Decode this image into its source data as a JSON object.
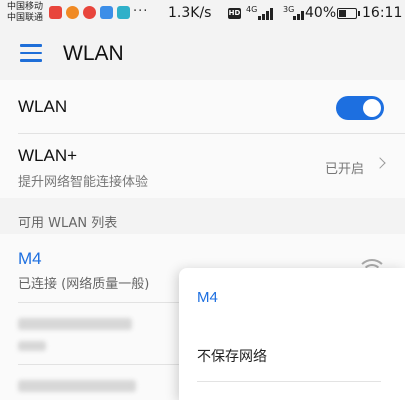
{
  "status_bar": {
    "carrier_1": "中国移动",
    "carrier_2": "中国联通",
    "dots": "···",
    "net_speed": "1.3K/s",
    "hd": "HD",
    "signal_1": "4G",
    "signal_2": "3G",
    "battery": "40%",
    "time": "16:11"
  },
  "app_bar": {
    "menu_icon": "hamburger-menu-icon",
    "title": "WLAN"
  },
  "settings": {
    "wlan_label": "WLAN",
    "wlan_enabled": true,
    "wlan_plus_label": "WLAN+",
    "wlan_plus_desc": "提升网络智能连接体验",
    "wlan_plus_value": "已开启"
  },
  "network_list": {
    "header": "可用 WLAN 列表",
    "connected": {
      "name": "M4",
      "status": "已连接 (网络质量一般)"
    }
  },
  "popup": {
    "title": "M4",
    "items": [
      "不保存网络"
    ]
  },
  "colors": {
    "accent": "#1d6fe0",
    "background": "#f3f3f3"
  }
}
